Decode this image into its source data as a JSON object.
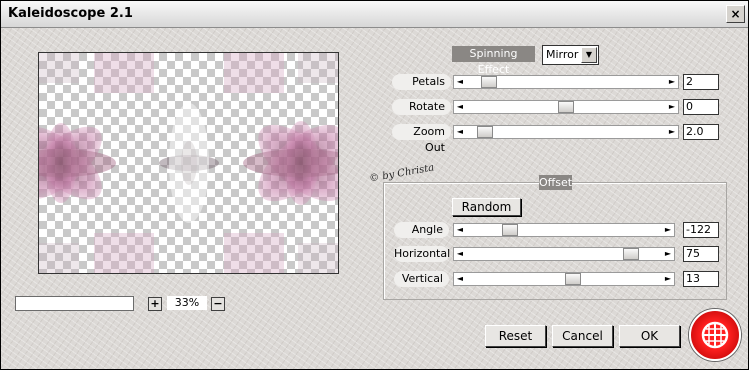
{
  "window": {
    "title": "Kaleidoscope 2.1",
    "close_glyph": "×"
  },
  "effect": {
    "label": "Spinning Effect",
    "selected": "Mirror",
    "dropdown_glyph": "▼"
  },
  "sliders": [
    {
      "label": "Petals",
      "value": "2",
      "position": 0.08
    },
    {
      "label": "Rotate",
      "value": "0",
      "position": 0.5
    },
    {
      "label": "Zoom Out",
      "value": "2.0",
      "position": 0.06
    }
  ],
  "offset": {
    "title": "Offset",
    "random_label": "Random",
    "sliders": [
      {
        "label": "Angle",
        "value": "-122",
        "position": 0.2
      },
      {
        "label": "Horizontal",
        "value": "75",
        "position": 0.87
      },
      {
        "label": "Vertical",
        "value": "13",
        "position": 0.55
      }
    ]
  },
  "signature": "© by Christa",
  "zoom": {
    "value": "33%",
    "plus": "+",
    "minus": "−"
  },
  "buttons": {
    "reset": "Reset",
    "cancel": "Cancel",
    "ok": "OK"
  },
  "arrows": {
    "left": "◄",
    "right": "►"
  },
  "colors": {
    "accent_label": "#8a8784",
    "logo": "#e01010",
    "petal": "#b4508c"
  },
  "logo_icon": "network-globe-icon"
}
